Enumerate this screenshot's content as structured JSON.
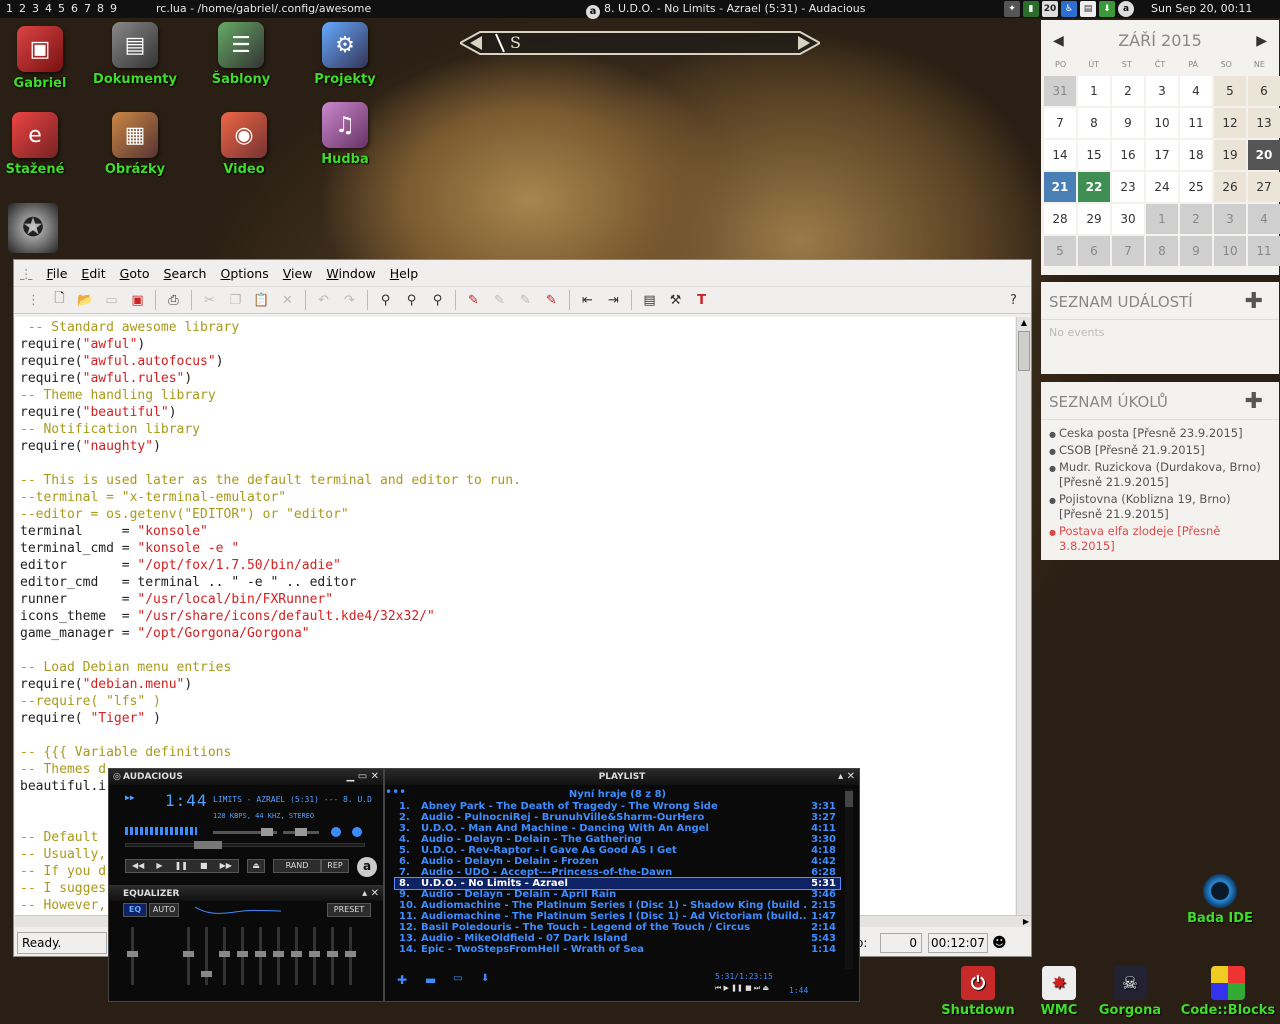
{
  "topbar": {
    "tags": [
      "1",
      "2",
      "3",
      "4",
      "5",
      "6",
      "7",
      "8",
      "9"
    ],
    "window_title": "rc.lua - /home/gabriel/.config/awesome",
    "now_playing": "8. U.D.O. - No Limits - Azrael (5:31) - Audacious",
    "tray_number": "20",
    "clock": "Sun Sep 20, 00:11"
  },
  "compass": {
    "letter": "S"
  },
  "desktop_icons": [
    {
      "label": "Gabriel"
    },
    {
      "label": "Dokumenty"
    },
    {
      "label": "Šablony"
    },
    {
      "label": "Projekty"
    },
    {
      "label": "Stažené"
    },
    {
      "label": "Obrázky"
    },
    {
      "label": "Video"
    },
    {
      "label": "Hudba"
    }
  ],
  "calendar": {
    "month": "ZÁŘÍ 2015",
    "weekdays": [
      "PO",
      "ÚT",
      "ST",
      "ČT",
      "PÁ",
      "SO",
      "NE"
    ],
    "days": [
      "31",
      "1",
      "2",
      "3",
      "4",
      "5",
      "6",
      "7",
      "8",
      "9",
      "10",
      "11",
      "12",
      "13",
      "14",
      "15",
      "16",
      "17",
      "18",
      "19",
      "20",
      "21",
      "22",
      "23",
      "24",
      "25",
      "26",
      "27",
      "28",
      "29",
      "30",
      "1",
      "2",
      "3",
      "4",
      "5",
      "6",
      "7",
      "8",
      "9",
      "10",
      "11"
    ]
  },
  "events": {
    "title": "SEZNAM UDÁLOSTÍ",
    "empty": "No events"
  },
  "tasks": {
    "title": "SEZNAM ÚKOLŮ",
    "items": [
      {
        "text": "Ceska posta [Přesně 23.9.2015]"
      },
      {
        "text": "CSOB [Přesně 21.9.2015]"
      },
      {
        "text": "Mudr. Ruzickova (Durdakova, Brno) [Přesně 21.9.2015]"
      },
      {
        "text": "Pojistovna (Koblizna 19, Brno) [Přesně 21.9.2015]"
      },
      {
        "text": "Postava elfa zlodeje [Přesně 3.8.2015]"
      }
    ]
  },
  "editor": {
    "menu": [
      "File",
      "Edit",
      "Goto",
      "Search",
      "Options",
      "View",
      "Window",
      "Help"
    ],
    "status": "Ready.",
    "line_label": "No:",
    "line_value": "0",
    "time": "00:12:07"
  },
  "audacious": {
    "title": "AUDACIOUS",
    "time": "1:44",
    "track": "LIMITS - AZRAEL (5:31) --- 8. U.D",
    "info": "128 KBPS, 44 KHZ, STEREO",
    "eq_title": "EQUALIZER",
    "eq_label": "EQ",
    "auto_label": "AUTO",
    "preset_label": "PRESET",
    "rand_label": "RAND",
    "rep_label": "REP"
  },
  "playlist": {
    "title": "PLAYLIST",
    "header": "Nyní hraje (8 z 8)",
    "items": [
      {
        "n": "1.",
        "t": "Abney Park - The Death of Tragedy - The Wrong Side",
        "len": "3:31"
      },
      {
        "n": "2.",
        "t": "Audio - PulnocniRej - BrunuhVille&Sharm-OurHero",
        "len": "3:27"
      },
      {
        "n": "3.",
        "t": "U.D.O. - Man And Machine - Dancing With An Angel",
        "len": "4:11"
      },
      {
        "n": "4.",
        "t": "Audio - Delayn - Delain - The Gathering",
        "len": "3:30"
      },
      {
        "n": "5.",
        "t": "U.D.O. - Rev-Raptor - I Gave As Good AS I Get",
        "len": "4:18"
      },
      {
        "n": "6.",
        "t": "Audio - Delayn - Delain - Frozen",
        "len": "4:42"
      },
      {
        "n": "7.",
        "t": "Audio - UDO - Accept---Princess-of-the-Dawn",
        "len": "6:28"
      },
      {
        "n": "8.",
        "t": "U.D.O. - No Limits - Azrael",
        "len": "5:31"
      },
      {
        "n": "9.",
        "t": "Audio - Delayn - Delain - April Rain",
        "len": "3:46"
      },
      {
        "n": "10.",
        "t": "Audiomachine - The Platinum Series I (Disc 1) - Shadow King (build ...",
        "len": "2:15"
      },
      {
        "n": "11.",
        "t": "Audiomachine - The Platinum Series I (Disc 1) - Ad Victoriam (build...",
        "len": "1:47"
      },
      {
        "n": "12.",
        "t": "Basil Poledouris - The Touch - Legend of the Touch / Circus",
        "len": "2:14"
      },
      {
        "n": "13.",
        "t": "Audio - MikeOldfield - 07 Dark Island",
        "len": "5:43"
      },
      {
        "n": "14.",
        "t": "Epic - TwoStepsFromHell - Wrath of Sea",
        "len": "1:14"
      }
    ],
    "current_index": 7,
    "total_time": "5:31/1:23:15",
    "elapsed": "1:44"
  },
  "dock": [
    {
      "label": "Bada IDE"
    },
    {
      "label": "Shutdown"
    },
    {
      "label": "WMC"
    },
    {
      "label": "Gorgona"
    },
    {
      "label": "Code::Blocks"
    }
  ]
}
